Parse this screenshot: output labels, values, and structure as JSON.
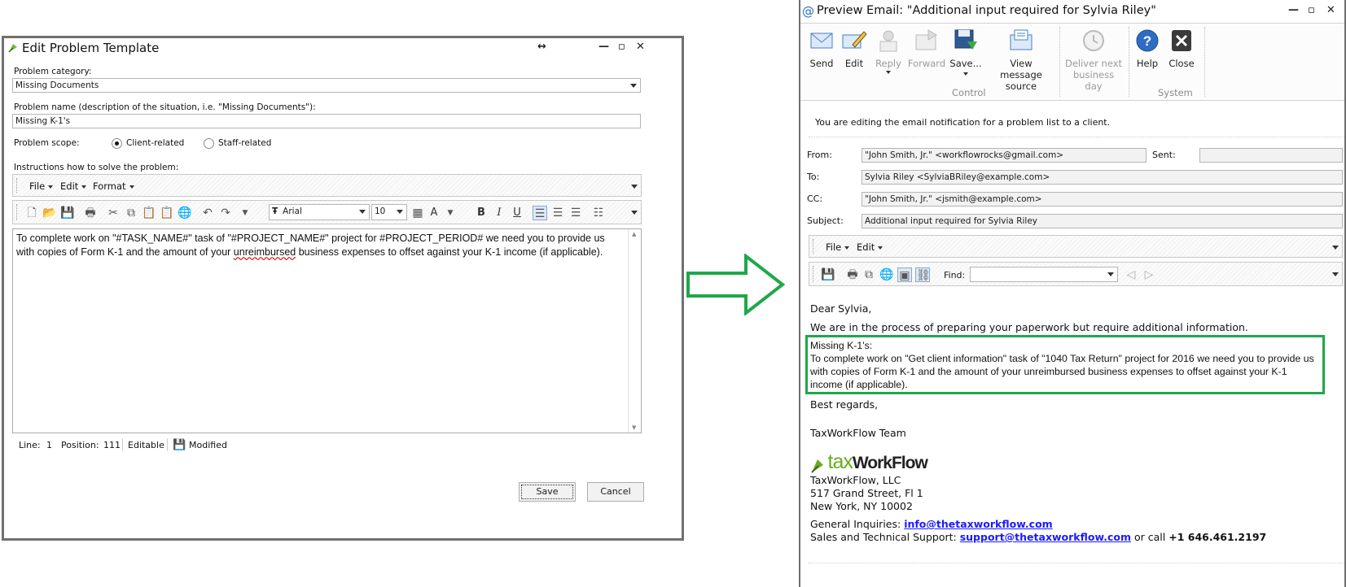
{
  "edit_window": {
    "title": "Edit Problem Template",
    "controls": {
      "move": "↔",
      "minimize": "—",
      "maximize": "▫",
      "close": "✕"
    },
    "category_label": "Problem category:",
    "category_value": "Missing Documents",
    "name_label": "Problem name (description of the situation, i.e. \"Missing Documents\"):",
    "name_value": "Missing K-1's",
    "scope_label": "Problem scope:",
    "scope_options": [
      "Client-related",
      "Staff-related"
    ],
    "scope_selected": "Client-related",
    "instructions_label": "Instructions how to solve the problem:",
    "menu": [
      "File",
      "Edit",
      "Format"
    ],
    "font_name": "Arial",
    "font_size": "10",
    "format_buttons": [
      "B",
      "I",
      "U"
    ],
    "editor_text_before": "To complete work on \"#TASK_NAME#\" task of \"#PROJECT_NAME#\" project for #PROJECT_PERIOD# we need you to provide us with copies of Form K-1 and the amount of your ",
    "editor_text_misspelled": "unreimbursed",
    "editor_text_after": " business expenses to offset against your K-1 income (if applicable).",
    "status": {
      "line_label": "Line:",
      "line_value": "1",
      "position_label": "Position:",
      "position_value": "111",
      "mode": "Editable",
      "state": "Modified"
    },
    "save_label": "Save",
    "cancel_label": "Cancel"
  },
  "preview_window": {
    "title": "Preview Email: \"Additional input required for Sylvia Riley\"",
    "ribbon": {
      "buttons": [
        {
          "label": "Send",
          "icon": "send-icon",
          "enabled": true
        },
        {
          "label": "Edit",
          "icon": "edit-icon",
          "enabled": true
        },
        {
          "label": "Reply",
          "icon": "reply-icon",
          "enabled": false
        },
        {
          "label": "Forward",
          "icon": "forward-icon",
          "enabled": false
        },
        {
          "label": "Save...",
          "icon": "save-icon",
          "enabled": true
        },
        {
          "label": "View message source",
          "icon": "message-source-icon",
          "enabled": true
        },
        {
          "label": "Deliver next business day",
          "icon": "clock-icon",
          "enabled": false
        },
        {
          "label": "Help",
          "icon": "help-icon",
          "enabled": true
        },
        {
          "label": "Close",
          "icon": "close-icon",
          "enabled": true
        }
      ],
      "groups": [
        "Control",
        "System"
      ]
    },
    "info": "You are editing the email notification for a problem list to a client.",
    "from_label": "From:",
    "from_value": "\"John Smith, Jr.\" <workflowrocks@gmail.com>",
    "sent_label": "Sent:",
    "to_label": "To:",
    "to_value": "Sylvia Riley <SylviaBRiley@example.com>",
    "cc_label": "CC:",
    "cc_value": "\"John Smith, Jr.\" <jsmith@example.com>",
    "subject_label": "Subject:",
    "subject_value": "Additional input required for Sylvia Riley",
    "menu": [
      "File",
      "Edit"
    ],
    "find_label": "Find:",
    "body": {
      "greeting": "Dear Sylvia,",
      "intro": "We are in the process of preparing your paperwork but require additional information.",
      "problem_title": "Missing K-1's:",
      "problem_text": "To complete work on \"Get client information\" task of \"1040 Tax Return\" project for 2016 we need you to provide us with copies of Form K-1 and the amount of your unreimbursed business expenses to offset against your K-1 income (if applicable).",
      "regards": "Best regards,",
      "team": "TaxWorkFlow Team",
      "logo_tax": "tax",
      "logo_workflow": "WorkFlow",
      "company": "TaxWorkFlow, LLC",
      "address1": "517 Grand Street, Fl 1",
      "address2": "New York, NY 10002",
      "inquiries_label": "General Inquiries:",
      "inquiries_email": "info@thetaxworkflow.com",
      "support_label": "Sales and Technical Support:",
      "support_email": "support@thetaxworkflow.com",
      "call_label": "or call",
      "phone": "+1 646.461.2197"
    }
  },
  "colors": {
    "highlight": "#1ea84a",
    "arrow": "#1ea84a",
    "link": "#1a1aff",
    "logo_green": "#6aaa1e"
  }
}
